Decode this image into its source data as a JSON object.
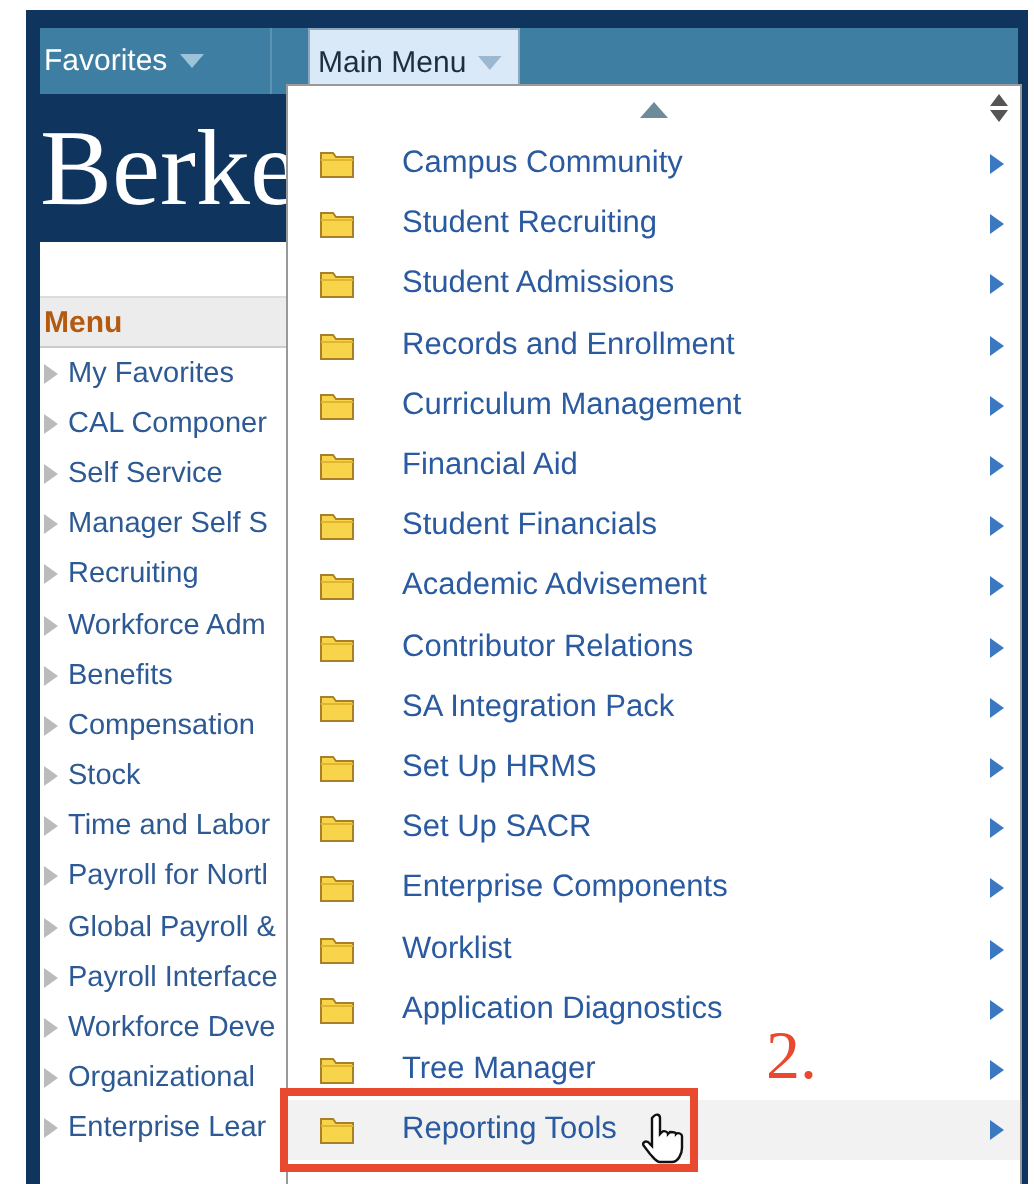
{
  "top_bar": {
    "items": [
      {
        "label": "Favorites",
        "selected": false
      },
      {
        "label": "Main Menu",
        "selected": true
      }
    ]
  },
  "logo": {
    "text": "Berke"
  },
  "sidebar": {
    "title": "Menu",
    "items": [
      "My Favorites",
      "CAL Componer",
      "Self Service",
      "Manager Self S",
      "Recruiting",
      "Workforce Adm",
      "Benefits",
      "Compensation",
      "Stock",
      "Time and Labor",
      "Payroll for Nortl",
      "Global Payroll &",
      "Payroll Interface",
      "Workforce Deve",
      "Organizational",
      "Enterprise Lear"
    ]
  },
  "main_menu": {
    "items": [
      {
        "label": "Campus Community",
        "selected": false
      },
      {
        "label": "Student Recruiting",
        "selected": false
      },
      {
        "label": "Student Admissions",
        "selected": false
      },
      {
        "label": "Records and Enrollment",
        "selected": false
      },
      {
        "label": "Curriculum Management",
        "selected": false
      },
      {
        "label": "Financial Aid",
        "selected": false
      },
      {
        "label": "Student Financials",
        "selected": false
      },
      {
        "label": "Academic Advisement",
        "selected": false
      },
      {
        "label": "Contributor Relations",
        "selected": false
      },
      {
        "label": "SA Integration Pack",
        "selected": false
      },
      {
        "label": "Set Up HRMS",
        "selected": false
      },
      {
        "label": "Set Up SACR",
        "selected": false
      },
      {
        "label": "Enterprise Components",
        "selected": false
      },
      {
        "label": "Worklist",
        "selected": false
      },
      {
        "label": "Application Diagnostics",
        "selected": false
      },
      {
        "label": "Tree Manager",
        "selected": false
      },
      {
        "label": "Reporting Tools",
        "selected": true
      }
    ]
  },
  "annotation": {
    "text": "2."
  }
}
